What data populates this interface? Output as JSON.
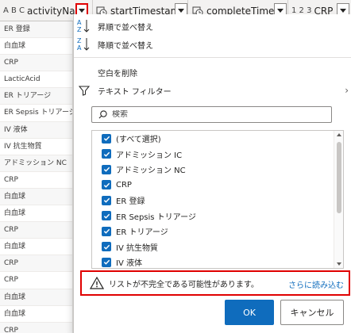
{
  "header": {
    "columns": [
      {
        "type_icon": "A B C",
        "title": "activityNa..."
      },
      {
        "type_icon": "clock",
        "title": "startTimestamp"
      },
      {
        "type_icon": "clock",
        "title": "completeTime"
      },
      {
        "type_icon": "1 2 3",
        "title": "CRP"
      }
    ]
  },
  "left_column": {
    "cells": [
      "ER 登録",
      "白血球",
      "CRP",
      "LacticAcid",
      "ER トリアージ",
      "ER Sepsis トリアージ",
      "IV 液体",
      "IV 抗生物質",
      "アドミッション NC",
      "CRP",
      "白血球",
      "白血球",
      "CRP",
      "白血球",
      "CRP",
      "CRP",
      "白血球",
      "白血球",
      "CRP"
    ]
  },
  "menu": {
    "sort_asc": "昇順で並べ替え",
    "sort_desc": "降順で並べ替え",
    "remove_blanks": "空白を削除",
    "text_filter": "テキスト フィルター",
    "sort_icon_top_asc": "A",
    "sort_icon_bottom_asc": "Z",
    "sort_icon_top_desc": "Z",
    "sort_icon_bottom_desc": "A"
  },
  "search": {
    "placeholder": "検索"
  },
  "filter_list": {
    "items": [
      "(すべて選択)",
      "アドミッション IC",
      "アドミッション NC",
      "CRP",
      "ER 登録",
      "ER Sepsis トリアージ",
      "ER トリアージ",
      "IV 抗生物質",
      "IV 液体"
    ]
  },
  "warning": {
    "text": "リストが不完全である可能性があります。",
    "link": "さらに読み込む"
  },
  "buttons": {
    "ok": "OK",
    "cancel": "キャンセル"
  },
  "colors": {
    "accent": "#0f6cbd",
    "highlight": "#e00000"
  }
}
